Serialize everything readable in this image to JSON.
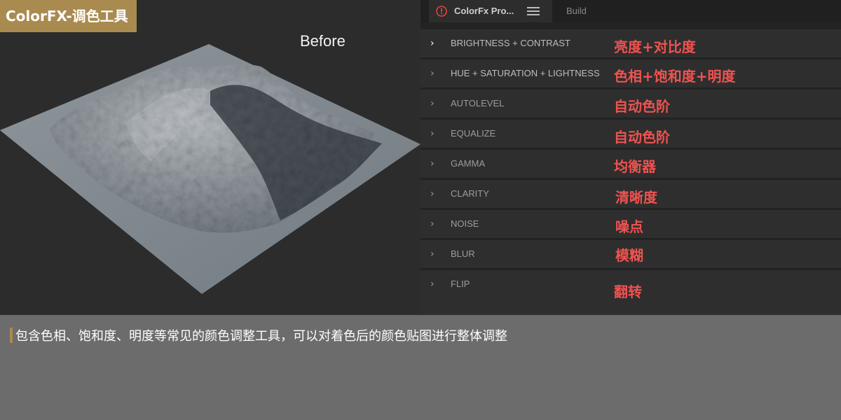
{
  "header": {
    "title": "ColorFX-调色工具"
  },
  "viewport": {
    "label": "Before"
  },
  "panel": {
    "tabs": [
      {
        "label": "ColorFx Pro...",
        "icon": "alert-icon",
        "active": true
      },
      {
        "label": "Build",
        "active": false
      }
    ],
    "menu_icon": "hamburger-menu-icon",
    "items": [
      {
        "label": "BRIGHTNESS + CONTRAST",
        "annotation": "亮度+对比度"
      },
      {
        "label": "HUE + SATURATION + LIGHTNESS",
        "annotation": "色相+饱和度+明度"
      },
      {
        "label": "AUTOLEVEL",
        "annotation": "自动色阶"
      },
      {
        "label": "EQUALIZE",
        "annotation": "自动色阶"
      },
      {
        "label": "GAMMA",
        "annotation": "均衡器"
      },
      {
        "label": "CLARITY",
        "annotation": "清晰度"
      },
      {
        "label": "NOISE",
        "annotation": "噪点"
      },
      {
        "label": "BLUR",
        "annotation": "模糊"
      },
      {
        "label": "FLIP",
        "annotation": "翻转"
      }
    ]
  },
  "description": "包含色相、饱和度、明度等常见的颜色调整工具，可以对着色后的颜色贴图进行整体调整",
  "colors": {
    "accent": "#a98a4f",
    "annotation": "#ee5350",
    "panel_row": "#2e2e2e",
    "viewport_bg": "#2c2c2c"
  }
}
